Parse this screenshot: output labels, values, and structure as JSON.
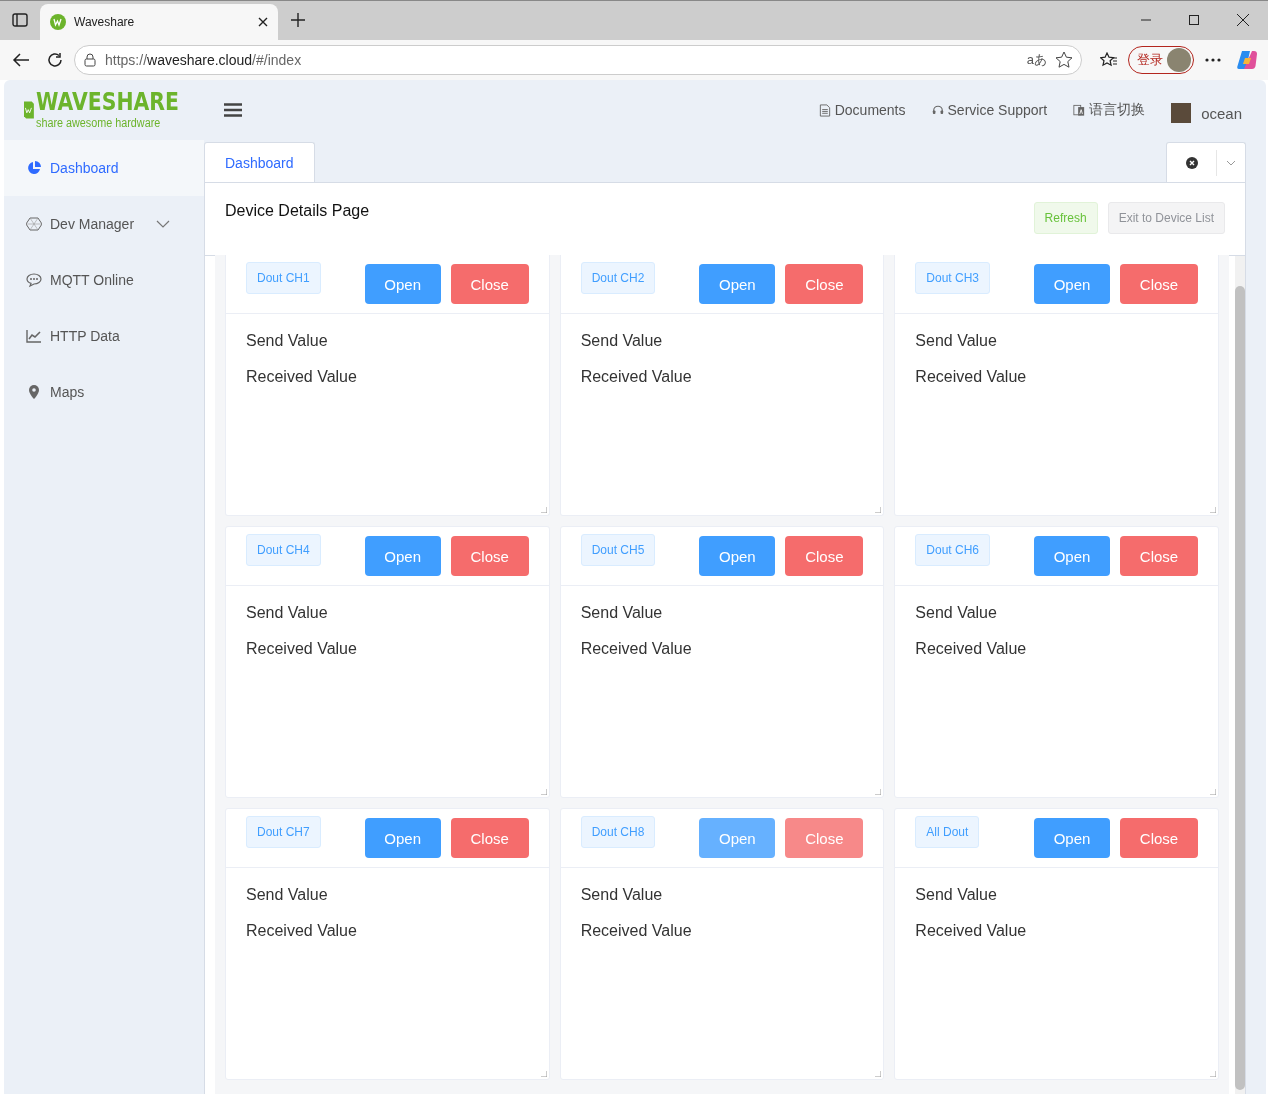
{
  "browser": {
    "tab_title": "Waveshare",
    "url_scheme": "https://",
    "url_host": "waveshare.cloud",
    "url_path": "/#/index",
    "translate_glyph": "aあ",
    "profile_label": "登录"
  },
  "header": {
    "logo_title": "WAVESHARE",
    "logo_tagline": "share awesome hardware",
    "links": [
      {
        "kind": "doc",
        "label": "Documents"
      },
      {
        "kind": "support",
        "label": "Service Support"
      },
      {
        "kind": "lang",
        "label": "语言切换"
      }
    ],
    "user": "ocean"
  },
  "sidebar": {
    "items": [
      {
        "kind": "pie",
        "label": "Dashboard",
        "selected": true,
        "expandable": false
      },
      {
        "kind": "hex",
        "label": "Dev Manager",
        "selected": false,
        "expandable": true
      },
      {
        "kind": "chat",
        "label": "MQTT Online",
        "selected": false,
        "expandable": false
      },
      {
        "kind": "chart",
        "label": "HTTP Data",
        "selected": false,
        "expandable": false
      },
      {
        "kind": "pin",
        "label": "Maps",
        "selected": false,
        "expandable": false
      }
    ]
  },
  "tabs": [
    {
      "label": "Dashboard",
      "selected": true
    }
  ],
  "page": {
    "title": "Device Details Page",
    "buttons": [
      {
        "kind": "success",
        "label": "Refresh"
      },
      {
        "kind": "plain",
        "label": "Exit to Device List"
      }
    ]
  },
  "cards": [
    {
      "channel": "Dout CH1",
      "open": "Open",
      "close": "Close",
      "dimmed": false,
      "send": "Send Value",
      "received": "Received Value"
    },
    {
      "channel": "Dout CH2",
      "open": "Open",
      "close": "Close",
      "dimmed": false,
      "send": "Send Value",
      "received": "Received Value"
    },
    {
      "channel": "Dout CH3",
      "open": "Open",
      "close": "Close",
      "dimmed": false,
      "send": "Send Value",
      "received": "Received Value"
    },
    {
      "channel": "Dout CH4",
      "open": "Open",
      "close": "Close",
      "dimmed": false,
      "send": "Send Value",
      "received": "Received Value"
    },
    {
      "channel": "Dout CH5",
      "open": "Open",
      "close": "Close",
      "dimmed": false,
      "send": "Send Value",
      "received": "Received Value"
    },
    {
      "channel": "Dout CH6",
      "open": "Open",
      "close": "Close",
      "dimmed": false,
      "send": "Send Value",
      "received": "Received Value"
    },
    {
      "channel": "Dout CH7",
      "open": "Open",
      "close": "Close",
      "dimmed": false,
      "send": "Send Value",
      "received": "Received Value"
    },
    {
      "channel": "Dout CH8",
      "open": "Open",
      "close": "Close",
      "dimmed": true,
      "send": "Send Value",
      "received": "Received Value"
    },
    {
      "channel": "All Dout",
      "open": "Open",
      "close": "Close",
      "dimmed": false,
      "send": "Send Value",
      "received": "Received Value"
    }
  ]
}
